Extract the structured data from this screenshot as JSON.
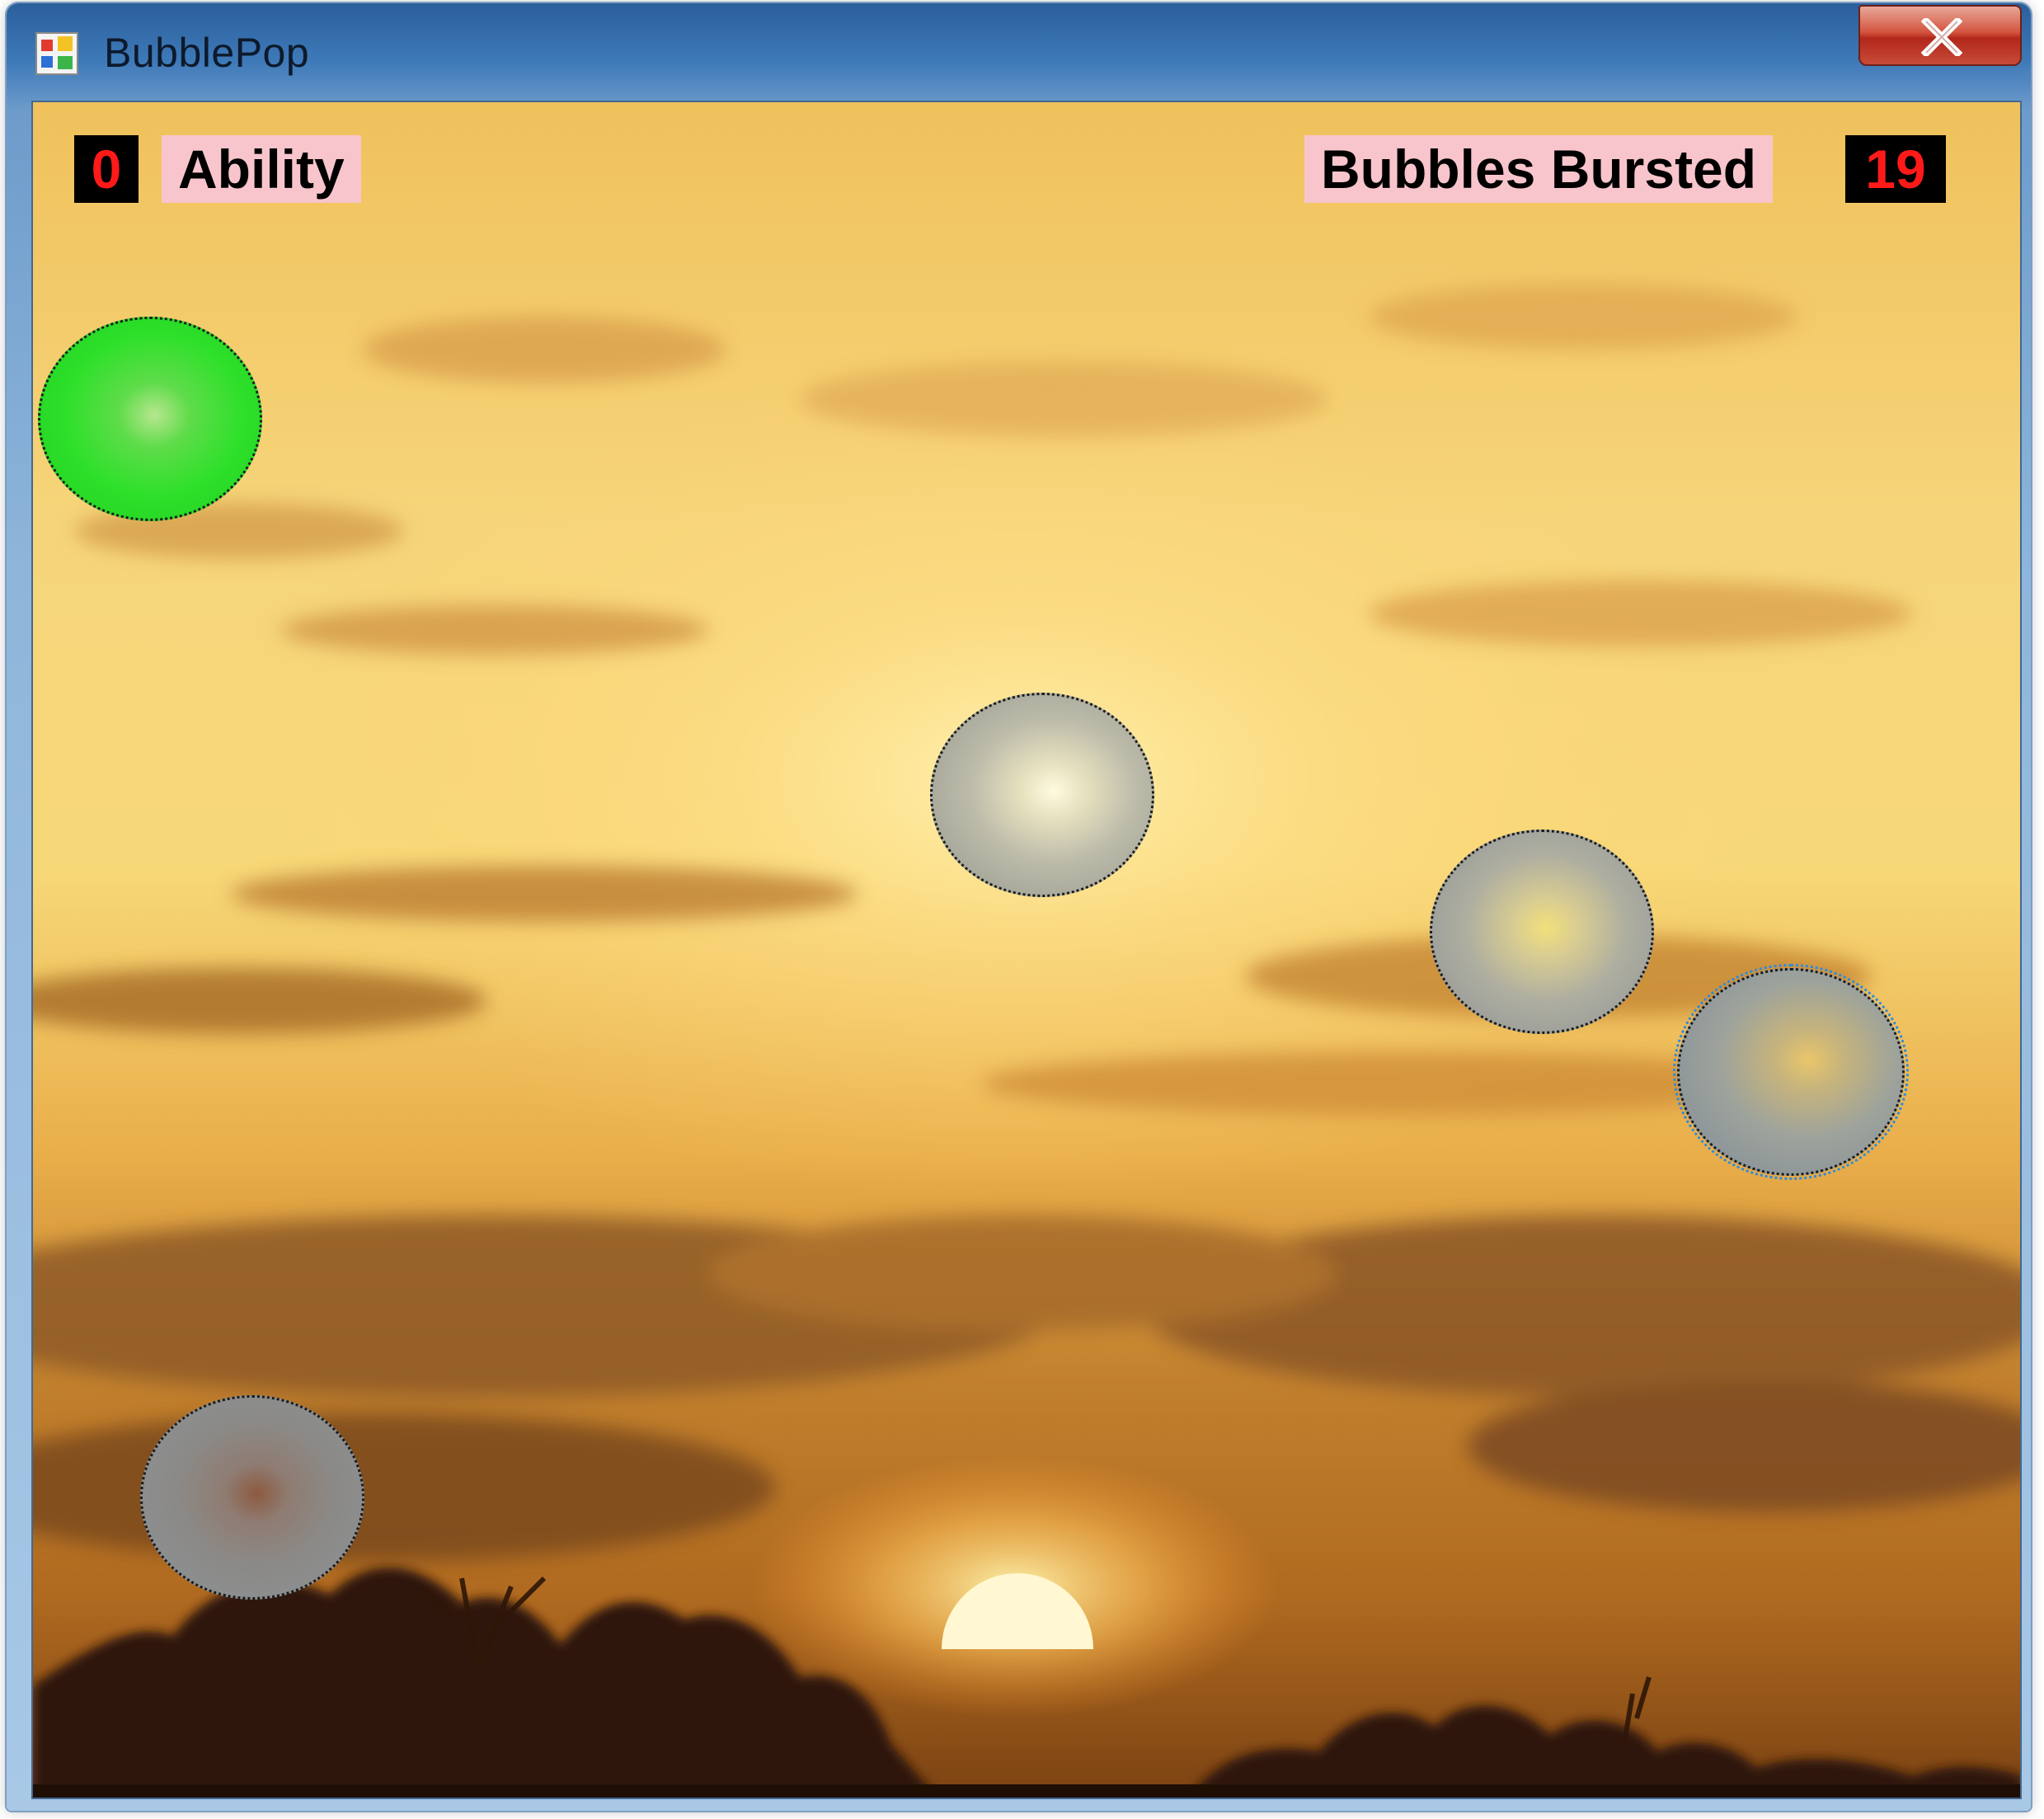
{
  "window": {
    "title": "BubblePop",
    "close_label": "X"
  },
  "hud": {
    "ability_value": "0",
    "ability_label": "Ability",
    "bursted_label": "Bubbles Bursted",
    "bursted_value": "19"
  },
  "bubbles": [
    {
      "kind": "green",
      "color": "#22e022"
    },
    {
      "kind": "gray",
      "color": "#a8a8a0"
    },
    {
      "kind": "gray",
      "color": "#a8a8a0"
    },
    {
      "kind": "gray",
      "color": "#a8a8a0",
      "selected": true
    },
    {
      "kind": "gray",
      "color": "#a8a8a0"
    }
  ],
  "colors": {
    "hud_number_text": "#ff1a1a",
    "hud_number_bg": "#000000",
    "hud_label_bg": "#f8c5cc",
    "close_button": "#c8402c"
  }
}
